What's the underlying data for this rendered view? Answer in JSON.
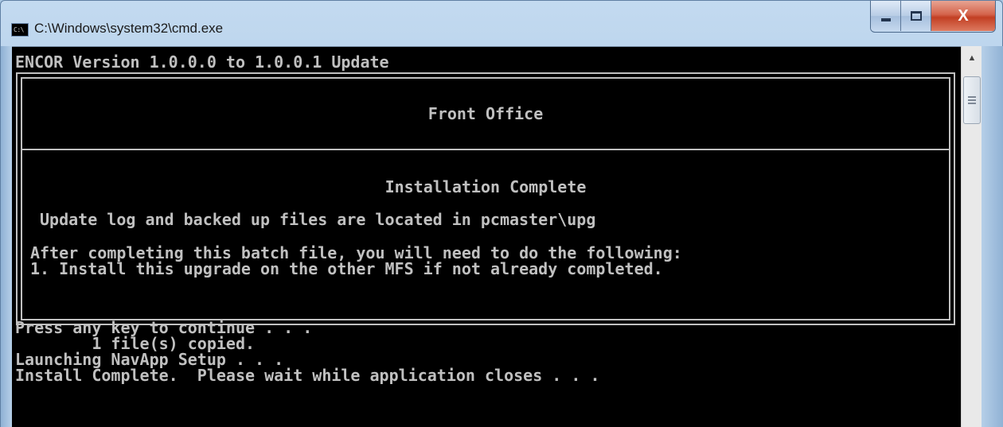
{
  "window": {
    "title": "C:\\Windows\\system32\\cmd.exe",
    "icon_text": "C:\\",
    "minimize_icon": "minimize-icon",
    "maximize_icon": "maximize-icon",
    "close_label": "X"
  },
  "console": {
    "header_line": "ENCOR Version 1.0.0.0 to 1.0.0.1 Update",
    "box": {
      "title": "Front Office",
      "status": "Installation Complete",
      "log_info": "Update log and backed up files are located in pcmaster\\upg",
      "instructions_line1": "After completing this batch file, you will need to do the following:",
      "instructions_line2": "1. Install this upgrade on the other MFS if not already completed."
    },
    "output_lines": [
      "Press any key to continue . . .",
      "        1 file(s) copied.",
      "Launching NavApp Setup . . .",
      "Install Complete.  Please wait while application closes . . ."
    ]
  },
  "colors": {
    "console_bg": "#000000",
    "console_fg": "#c0c0c0",
    "close_button": "#c23f23"
  }
}
